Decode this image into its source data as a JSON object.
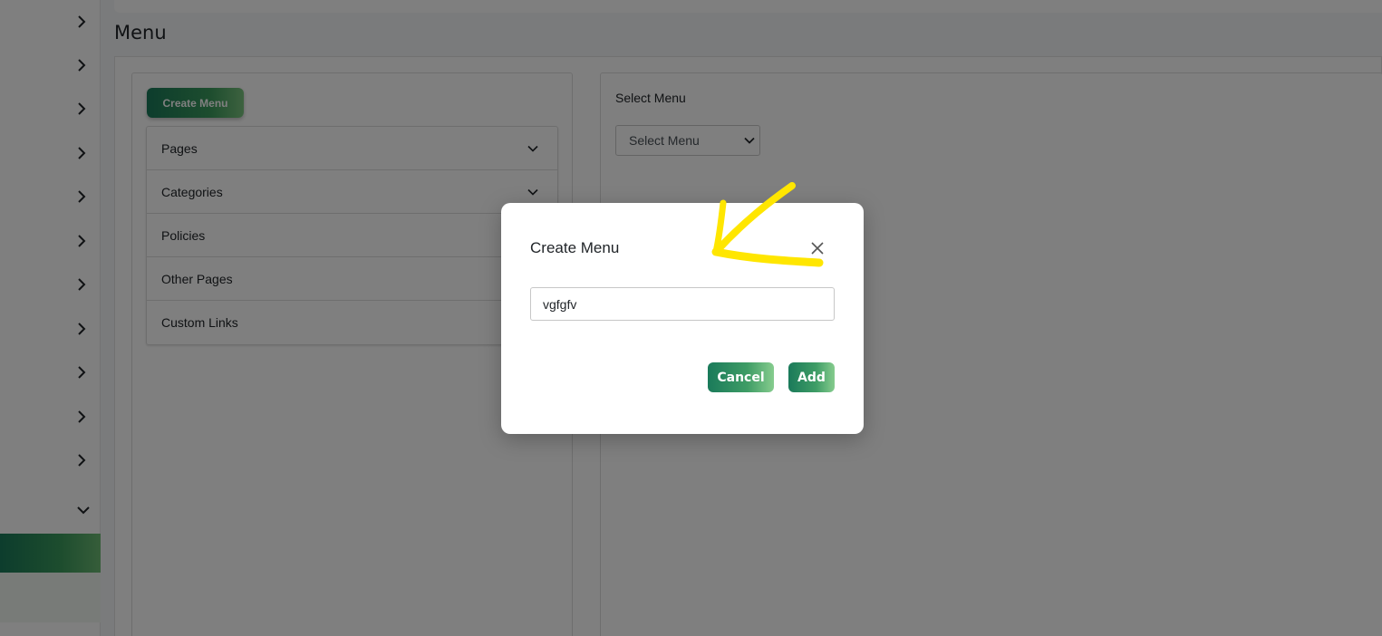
{
  "page": {
    "title": "Menu"
  },
  "left_panel": {
    "create_button": "Create Menu",
    "accordion": [
      {
        "label": "Pages",
        "icon": "chevron-down-icon"
      },
      {
        "label": "Categories",
        "icon": "chevron-down-icon"
      },
      {
        "label": "Policies"
      },
      {
        "label": "Other Pages"
      },
      {
        "label": "Custom Links"
      }
    ]
  },
  "right_panel": {
    "select_label": "Select Menu",
    "select_value": "Select Menu"
  },
  "modal": {
    "title": "Create Menu",
    "input_value": "vgfgfv",
    "cancel_label": "Cancel",
    "add_label": "Add"
  },
  "colors": {
    "brand_dark": "#1a7a5a",
    "brand_light": "#7bc47f",
    "annotation": "#ffe600"
  },
  "sidebar": {
    "icons": [
      "chevron-right-icon",
      "chevron-right-icon",
      "chevron-right-icon",
      "chevron-right-icon",
      "chevron-right-icon",
      "chevron-right-icon",
      "chevron-right-icon",
      "chevron-right-icon",
      "chevron-right-icon",
      "chevron-right-icon",
      "chevron-right-icon",
      "chevron-down-icon"
    ]
  }
}
